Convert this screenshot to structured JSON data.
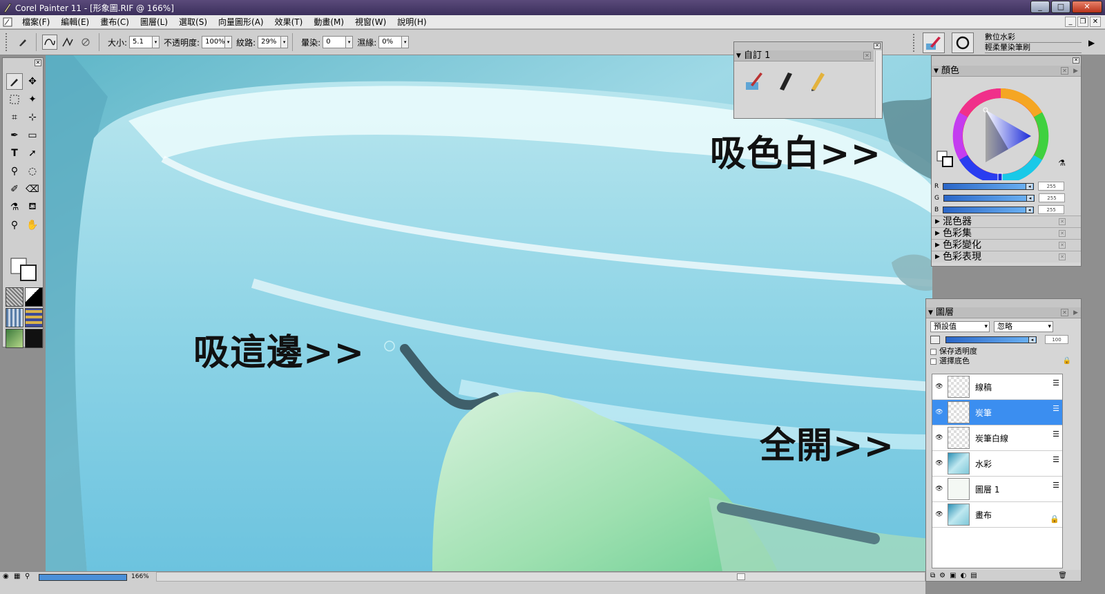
{
  "window": {
    "title": "Corel Painter 11 - [形象圖.RIF @ 166%]"
  },
  "menu": [
    "檔案(F)",
    "編輯(E)",
    "畫布(C)",
    "圖層(L)",
    "選取(S)",
    "向量圖形(A)",
    "效果(T)",
    "動畫(M)",
    "視窗(W)",
    "說明(H)"
  ],
  "property_bar": {
    "size_label": "大小:",
    "size_value": "5.1",
    "opacity_label": "不透明度:",
    "opacity_value": "100%",
    "grain_label": "紋路:",
    "grain_value": "29%",
    "diffusion_label": "暈染:",
    "diffusion_value": "0",
    "wet_fringe_label": "濕緣:",
    "wet_fringe_value": "0%"
  },
  "brush_selector": {
    "category": "數位水彩",
    "variant": "輕柔暈染筆刷"
  },
  "custom_palette": {
    "title": "自訂 1"
  },
  "annotations": {
    "pick_white": "吸色白>>",
    "pick_here": "吸這邊>>",
    "all_open": "全開>>"
  },
  "color_panel": {
    "title": "顏色",
    "rgb": [
      {
        "ch": "R",
        "val": "255"
      },
      {
        "ch": "G",
        "val": "255"
      },
      {
        "ch": "B",
        "val": "255"
      }
    ],
    "subpanels": [
      "混色器",
      "色彩集",
      "色彩變化",
      "色彩表現"
    ]
  },
  "layers_panel": {
    "title": "圖層",
    "composite_method": "預設值",
    "composite_depth": "忽略",
    "opacity_value": "100",
    "preserve_transparency": "保存透明度",
    "pick_up_color": "選擇底色",
    "layers": [
      {
        "name": "線稿",
        "thumb": "checker"
      },
      {
        "name": "炭筆",
        "thumb": "checker",
        "selected": true
      },
      {
        "name": "炭筆白線",
        "thumb": "checker"
      },
      {
        "name": "水彩",
        "thumb": "image"
      },
      {
        "name": "圖層 1",
        "thumb": "white"
      },
      {
        "name": "畫布",
        "thumb": "image"
      }
    ]
  },
  "status": {
    "zoom": "166%"
  },
  "colors": {
    "titlebar": "#3b2f5c",
    "selected_layer": "#3b8ef0",
    "canvas_teal": "#7fc9da"
  }
}
